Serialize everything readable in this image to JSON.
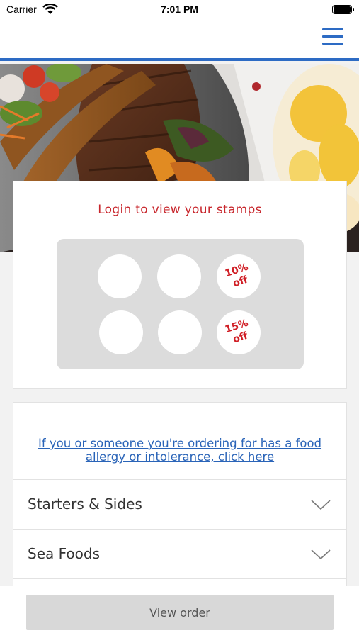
{
  "status_bar": {
    "carrier": "Carrier",
    "time": "7:01 PM",
    "icons": [
      "wifi-icon",
      "battery-icon"
    ]
  },
  "header": {
    "menu_icon": "hamburger-menu-icon",
    "accent_color": "#2d6bc4"
  },
  "hero": {
    "image": "grilled-kebab-platter-with-saffron-rice"
  },
  "stamp_card": {
    "login_text": "Login to view your stamps",
    "login_color": "#c8262c",
    "stamps": [
      {
        "reward": ""
      },
      {
        "reward": ""
      },
      {
        "reward_line1": "10%",
        "reward_line2": "off"
      },
      {
        "reward": ""
      },
      {
        "reward": ""
      },
      {
        "reward_line1": "15%",
        "reward_line2": "off"
      }
    ]
  },
  "menu": {
    "allergy_text": "If you or someone you're ordering for has a food allergy or intolerance, click here",
    "link_color": "#2a64b8",
    "categories": [
      {
        "label": "Starters & Sides",
        "icon": "chevron-down-icon"
      },
      {
        "label": "Sea Foods",
        "icon": "chevron-down-icon"
      }
    ]
  },
  "footer": {
    "view_order_label": "View order"
  }
}
